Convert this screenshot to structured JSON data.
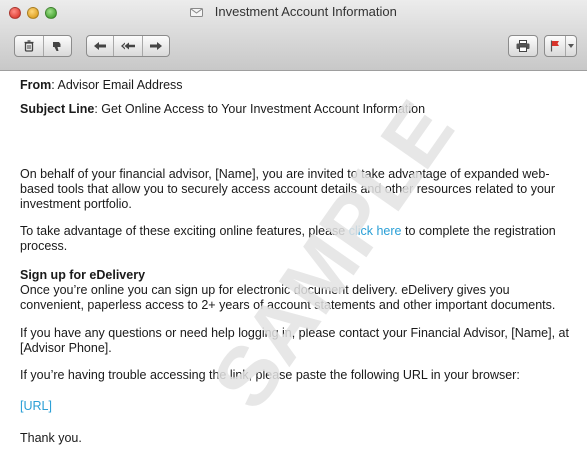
{
  "window": {
    "title": "Investment Account Information"
  },
  "toolbar": {
    "buttons": [
      {
        "name": "delete-icon"
      },
      {
        "name": "junk-icon"
      },
      {
        "name": "reply-icon"
      },
      {
        "name": "reply-all-icon"
      },
      {
        "name": "forward-icon"
      },
      {
        "name": "print-icon"
      },
      {
        "name": "flag-icon"
      }
    ]
  },
  "email": {
    "from_label": "From",
    "from_value": ": Advisor Email Address",
    "subject_label": "Subject Line",
    "subject_value": ": Get Online Access to Your Investment Account Information",
    "para1": "On behalf of your financial advisor, [Name], you are invited to take advantage of expanded web-based tools that allow you to securely access account details and other resources related to your investment portfolio.",
    "para2_before": "To take advantage of these exciting online features, please ",
    "para2_link": "click here",
    "para2_after": " to complete the registration process.",
    "section_heading": "Sign up for eDelivery",
    "section_text": "Once you’re online you can sign up for electronic document delivery. eDelivery gives you convenient, paperless access to 2+ years of account statements and other important documents.",
    "para4": "If you have any questions or need help logging in, please contact your Financial Advisor, [Name], at [Advisor Phone].",
    "para5": "If you’re having trouble accessing the link, please paste the following URL in your browser:",
    "url_link": "[URL]",
    "closing": "Thank you."
  },
  "watermark": {
    "text": "SAMPLE"
  },
  "colors": {
    "link": "#2a9fd6",
    "watermark": "#e3e3e3"
  }
}
